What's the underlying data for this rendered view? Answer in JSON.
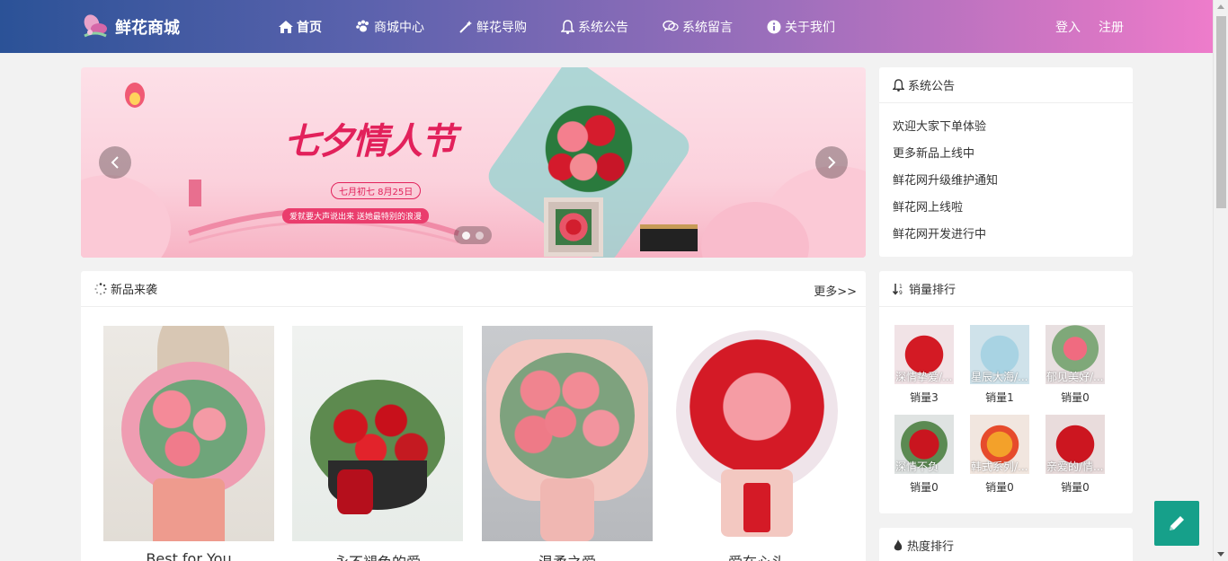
{
  "brand": {
    "name": "鲜花商城"
  },
  "nav": {
    "items": [
      {
        "label": "首页",
        "icon": "home-icon"
      },
      {
        "label": "商城中心",
        "icon": "paw-icon"
      },
      {
        "label": "鲜花导购",
        "icon": "magic-wand-icon"
      },
      {
        "label": "系统公告",
        "icon": "bell-icon"
      },
      {
        "label": "系统留言",
        "icon": "chat-icon"
      },
      {
        "label": "关于我们",
        "icon": "info-icon"
      }
    ],
    "login": "登入",
    "register": "注册"
  },
  "banner": {
    "title": "七夕情人节",
    "date": "七月初七  8月25日",
    "slogan": "爱就要大声说出来  送她最特别的浪漫",
    "slides": 2,
    "active_slide": 1
  },
  "notice": {
    "title": "系统公告",
    "items": [
      "欢迎大家下单体验",
      "更多新品上线中",
      "鲜花网升级维护通知",
      "鲜花网上线啦",
      "鲜花网开发进行中"
    ]
  },
  "new_products": {
    "title": "新品来袭",
    "more": "更多>>",
    "items": [
      {
        "name": "Best for You"
      },
      {
        "name": "永不褪色的爱"
      },
      {
        "name": "温柔之爱"
      },
      {
        "name": "爱在心头"
      }
    ]
  },
  "sales_rank": {
    "title": "销量排行",
    "items": [
      {
        "name": "深情挚爱/...",
        "sold": "销量3"
      },
      {
        "name": "星辰大海/...",
        "sold": "销量1"
      },
      {
        "name": "郁见美好/...",
        "sold": "销量0"
      },
      {
        "name": "深情不负",
        "sold": "销量0"
      },
      {
        "name": "韩式系列/...",
        "sold": "销量0"
      },
      {
        "name": "亲爱的/情...",
        "sold": "销量0"
      }
    ]
  },
  "hot_rank": {
    "title": "热度排行"
  },
  "colors": {
    "accent": "#16a08a",
    "brand_pink": "#e2215b"
  }
}
